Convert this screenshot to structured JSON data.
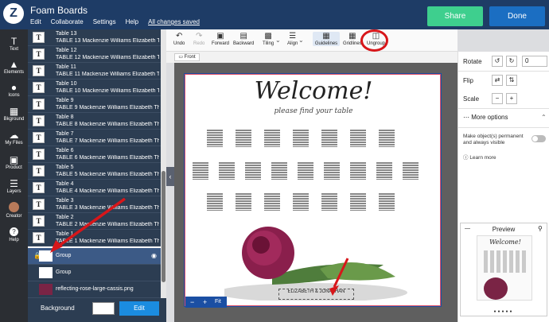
{
  "app": {
    "logo": "Z",
    "title": "Foam Boards"
  },
  "menu": {
    "edit": "Edit",
    "collaborate": "Collaborate",
    "settings": "Settings",
    "help": "Help",
    "saved": "All changes saved"
  },
  "actions": {
    "share": "Share",
    "done": "Done"
  },
  "leftnav": [
    {
      "label": "Text",
      "icon": "text-icon"
    },
    {
      "label": "Elements",
      "icon": "elements-icon"
    },
    {
      "label": "Icons",
      "icon": "icons-icon"
    },
    {
      "label": "Bkground",
      "icon": "background-icon"
    },
    {
      "label": "My Files",
      "icon": "cloud-icon"
    },
    {
      "label": "Product",
      "icon": "product-icon"
    },
    {
      "label": "Layers",
      "icon": "layers-icon"
    },
    {
      "label": "Creator",
      "icon": "avatar"
    },
    {
      "label": "Help",
      "icon": "help-icon"
    }
  ],
  "layers": [
    {
      "name": "Table 13",
      "detail": "TABLE 13 Mackenzie Williams Elizabeth Thomps..."
    },
    {
      "name": "Table 12",
      "detail": "TABLE 12 Mackenzie Williams Elizabeth Thomps..."
    },
    {
      "name": "Table 11",
      "detail": "TABLE 11 Mackenzie Williams Elizabeth Thomps..."
    },
    {
      "name": "Table 10",
      "detail": "TABLE 10 Mackenzie Williams Elizabeth Thomps..."
    },
    {
      "name": "Table 9",
      "detail": "TABLE 9 Mackenzie Williams Elizabeth Thomps..."
    },
    {
      "name": "Table 8",
      "detail": "TABLE 8 Mackenzie Williams Elizabeth Thomps..."
    },
    {
      "name": "Table 7",
      "detail": "TABLE 7 Mackenzie Williams Elizabeth Thomps..."
    },
    {
      "name": "Table 6",
      "detail": "TABLE 6 Mackenzie Williams Elizabeth Thomps..."
    },
    {
      "name": "Table 5",
      "detail": "TABLE 5 Mackenzie Williams Elizabeth Thomps..."
    },
    {
      "name": "Table 4",
      "detail": "TABLE 4 Mackenzie Williams Elizabeth Thomps..."
    },
    {
      "name": "Table 3",
      "detail": "TABLE 3 Mackenzie Williams Elizabeth Thomps..."
    },
    {
      "name": "Table 2",
      "detail": "TABLE 2 Mackenzie Williams Elizabeth Thomps..."
    },
    {
      "name": "Table 1",
      "detail": "TABLE 1 Mackenzie Williams Elizabeth Thomps..."
    }
  ],
  "layer_rows_extra": {
    "group_selected": "Group",
    "group": "Group",
    "image": "reflecting-rose-large-cassis.png"
  },
  "background": {
    "label": "Background",
    "edit": "Edit"
  },
  "toolbar": {
    "undo": "Undo",
    "redo": "Redo",
    "forward": "Forward",
    "backward": "Backward",
    "tiling": "Tiling",
    "align": "Align",
    "guidelines": "Guidelines",
    "gridlines": "Gridlines",
    "ungroup": "Ungroup",
    "front": "Front"
  },
  "canvas": {
    "welcome": "Welcome!",
    "subtitle": "please find your table",
    "namebox": "ELIZABETH & JONATHAN"
  },
  "zoom": {
    "minus": "−",
    "plus": "+",
    "fit": "Fit"
  },
  "props": {
    "rotate": "Rotate",
    "rotate_value": "0",
    "flip": "Flip",
    "scale": "Scale",
    "more": "More options",
    "permanent": "Make object(s) permanent and always visible",
    "learn": "Learn more"
  },
  "preview": {
    "title": "Preview",
    "welcome": "Welcome!"
  },
  "colors": {
    "topbar": "#1e3c66",
    "share": "#3ecf8e",
    "done": "#1b6ec2",
    "annotation": "#d7161a"
  }
}
